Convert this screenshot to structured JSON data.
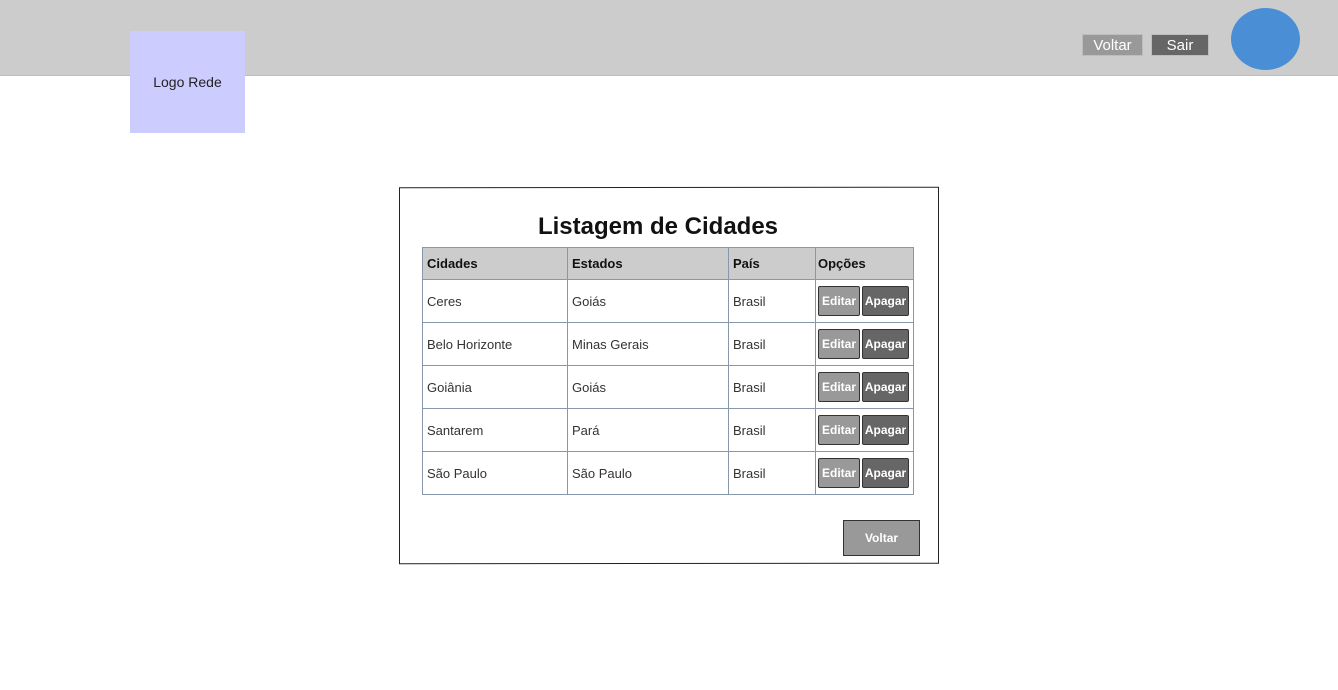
{
  "header": {
    "logo_label": "Logo Rede",
    "back_label": "Voltar",
    "logout_label": "Sair"
  },
  "main": {
    "title": "Listagem de Cidades",
    "columns": [
      "Cidades",
      "Estados",
      "País",
      "Opções"
    ],
    "rows": [
      {
        "city": "Ceres",
        "state": "Goiás",
        "country": "Brasil"
      },
      {
        "city": "Belo Horizonte",
        "state": "Minas Gerais",
        "country": "Brasil"
      },
      {
        "city": "Goiânia",
        "state": "Goiás",
        "country": "Brasil"
      },
      {
        "city": "Santarem",
        "state": "Pará",
        "country": "Brasil"
      },
      {
        "city": "São Paulo",
        "state": "São Paulo",
        "country": "Brasil"
      }
    ],
    "edit_label": "Editar",
    "delete_label": "Apagar",
    "back_label": "Voltar"
  },
  "colors": {
    "topbar": "#cccccc",
    "logo_bg": "#ccccff",
    "avatar": "#4a8fd6",
    "btn_light": "#999999",
    "btn_dark": "#666666"
  }
}
